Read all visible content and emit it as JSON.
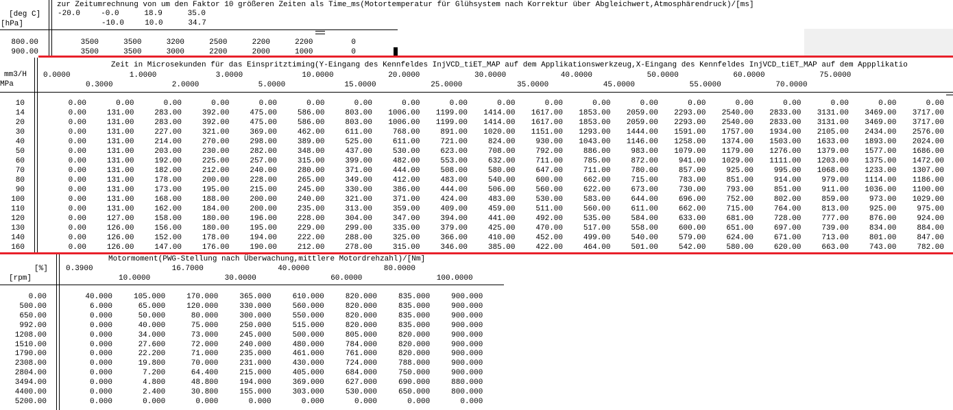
{
  "section1": {
    "title": "zur Zeitumrechnung von um den Faktor 10 größeren Zeiten als Time_ms(Motortemperatur für Glühsystem nach Korrektur über Abgleichwert,Atmosphärendruck)/[ms]",
    "x_unit": "[deg C]",
    "y_unit": "[hPa]",
    "x_row1": [
      "-20.0",
      "-0.0",
      "18.9",
      "35.0"
    ],
    "x_row2": [
      "-10.0",
      "10.0",
      "34.7"
    ],
    "rows": [
      {
        "label": "800.00",
        "values": [
          "3500",
          "3500",
          "3200",
          "2500",
          "2200",
          "2200",
          "0"
        ]
      },
      {
        "label": "900.00",
        "values": [
          "3500",
          "3500",
          "3000",
          "2200",
          "2000",
          "1000",
          "0"
        ]
      }
    ]
  },
  "section2": {
    "title": "Zeit in Microsekunden für das Einspritztiming(Y-Eingang des Kennfeldes InjVCD_tiET_MAP auf dem Applikationswerkzeug,X-Eingang des Kennfeldes InjVCD_tiET_MAP auf dem Appplikatio",
    "x_unit": "mm3/H",
    "y_unit": "MPa",
    "x_row1": [
      "0.0000",
      "1.0000",
      "3.0000",
      "10.0000",
      "20.0000",
      "30.0000",
      "40.0000",
      "50.0000",
      "60.0000",
      "75.0000"
    ],
    "x_row2": [
      "0.3000",
      "2.0000",
      "5.0000",
      "15.0000",
      "25.0000",
      "35.0000",
      "45.0000",
      "55.0000",
      "70.0000"
    ],
    "rows": [
      {
        "label": "10",
        "values": [
          "0.00",
          "0.00",
          "0.00",
          "0.00",
          "0.00",
          "0.00",
          "0.00",
          "0.00",
          "0.00",
          "0.00",
          "0.00",
          "0.00",
          "0.00",
          "0.00",
          "0.00",
          "0.00",
          "0.00",
          "0.00",
          "0.00"
        ]
      },
      {
        "label": "14",
        "values": [
          "0.00",
          "131.00",
          "283.00",
          "392.00",
          "475.00",
          "586.00",
          "803.00",
          "1006.00",
          "1199.00",
          "1414.00",
          "1617.00",
          "1853.00",
          "2059.00",
          "2293.00",
          "2540.00",
          "2833.00",
          "3131.00",
          "3469.00",
          "3717.00"
        ]
      },
      {
        "label": "20",
        "values": [
          "0.00",
          "131.00",
          "283.00",
          "392.00",
          "475.00",
          "586.00",
          "803.00",
          "1006.00",
          "1199.00",
          "1414.00",
          "1617.00",
          "1853.00",
          "2059.00",
          "2293.00",
          "2540.00",
          "2833.00",
          "3131.00",
          "3469.00",
          "3717.00"
        ]
      },
      {
        "label": "30",
        "values": [
          "0.00",
          "131.00",
          "227.00",
          "321.00",
          "369.00",
          "462.00",
          "611.00",
          "768.00",
          "891.00",
          "1020.00",
          "1151.00",
          "1293.00",
          "1444.00",
          "1591.00",
          "1757.00",
          "1934.00",
          "2105.00",
          "2434.00",
          "2576.00"
        ]
      },
      {
        "label": "40",
        "values": [
          "0.00",
          "131.00",
          "214.00",
          "270.00",
          "298.00",
          "389.00",
          "525.00",
          "611.00",
          "721.00",
          "824.00",
          "930.00",
          "1043.00",
          "1146.00",
          "1258.00",
          "1374.00",
          "1503.00",
          "1633.00",
          "1893.00",
          "2024.00"
        ]
      },
      {
        "label": "50",
        "values": [
          "0.00",
          "131.00",
          "203.00",
          "230.00",
          "282.00",
          "348.00",
          "437.00",
          "530.00",
          "623.00",
          "708.00",
          "792.00",
          "886.00",
          "983.00",
          "1079.00",
          "1179.00",
          "1276.00",
          "1379.00",
          "1577.00",
          "1686.00"
        ]
      },
      {
        "label": "60",
        "values": [
          "0.00",
          "131.00",
          "192.00",
          "225.00",
          "257.00",
          "315.00",
          "399.00",
          "482.00",
          "553.00",
          "632.00",
          "711.00",
          "785.00",
          "872.00",
          "941.00",
          "1029.00",
          "1111.00",
          "1203.00",
          "1375.00",
          "1472.00"
        ]
      },
      {
        "label": "70",
        "values": [
          "0.00",
          "131.00",
          "182.00",
          "212.00",
          "240.00",
          "280.00",
          "371.00",
          "444.00",
          "508.00",
          "580.00",
          "647.00",
          "711.00",
          "780.00",
          "857.00",
          "925.00",
          "995.00",
          "1068.00",
          "1233.00",
          "1307.00"
        ]
      },
      {
        "label": "80",
        "values": [
          "0.00",
          "131.00",
          "178.00",
          "200.00",
          "228.00",
          "265.00",
          "349.00",
          "412.00",
          "483.00",
          "540.00",
          "600.00",
          "662.00",
          "715.00",
          "783.00",
          "851.00",
          "914.00",
          "979.00",
          "1114.00",
          "1186.00"
        ]
      },
      {
        "label": "90",
        "values": [
          "0.00",
          "131.00",
          "173.00",
          "195.00",
          "215.00",
          "245.00",
          "330.00",
          "386.00",
          "444.00",
          "506.00",
          "560.00",
          "622.00",
          "673.00",
          "730.00",
          "793.00",
          "851.00",
          "911.00",
          "1036.00",
          "1100.00"
        ]
      },
      {
        "label": "100",
        "values": [
          "0.00",
          "131.00",
          "168.00",
          "188.00",
          "200.00",
          "240.00",
          "321.00",
          "371.00",
          "424.00",
          "483.00",
          "530.00",
          "583.00",
          "644.00",
          "696.00",
          "752.00",
          "802.00",
          "859.00",
          "973.00",
          "1029.00"
        ]
      },
      {
        "label": "110",
        "values": [
          "0.00",
          "131.00",
          "162.00",
          "184.00",
          "200.00",
          "235.00",
          "313.00",
          "359.00",
          "409.00",
          "459.00",
          "511.00",
          "560.00",
          "611.00",
          "662.00",
          "715.00",
          "764.00",
          "813.00",
          "925.00",
          "975.00"
        ]
      },
      {
        "label": "120",
        "values": [
          "0.00",
          "127.00",
          "158.00",
          "180.00",
          "196.00",
          "228.00",
          "304.00",
          "347.00",
          "394.00",
          "441.00",
          "492.00",
          "535.00",
          "584.00",
          "633.00",
          "681.00",
          "728.00",
          "777.00",
          "876.00",
          "924.00"
        ]
      },
      {
        "label": "130",
        "values": [
          "0.00",
          "126.00",
          "156.00",
          "180.00",
          "195.00",
          "229.00",
          "299.00",
          "335.00",
          "379.00",
          "425.00",
          "470.00",
          "517.00",
          "558.00",
          "600.00",
          "651.00",
          "697.00",
          "739.00",
          "834.00",
          "884.00"
        ]
      },
      {
        "label": "140",
        "values": [
          "0.00",
          "126.00",
          "152.00",
          "178.00",
          "194.00",
          "222.00",
          "288.00",
          "325.00",
          "366.00",
          "410.00",
          "452.00",
          "499.00",
          "540.00",
          "579.00",
          "624.00",
          "671.00",
          "713.00",
          "801.00",
          "847.00"
        ]
      },
      {
        "label": "160",
        "values": [
          "0.00",
          "126.00",
          "147.00",
          "176.00",
          "190.00",
          "212.00",
          "278.00",
          "315.00",
          "346.00",
          "385.00",
          "422.00",
          "464.00",
          "501.00",
          "542.00",
          "580.00",
          "620.00",
          "663.00",
          "743.00",
          "782.00"
        ]
      }
    ]
  },
  "section3": {
    "title": "Motormoment(PWG-Stellung nach Überwachung,mittlere Motordrehzahl)/[Nm]",
    "x_unit": "[%]",
    "y_unit": "[rpm]",
    "x_row1": [
      "0.3900",
      "16.7000",
      "40.0000",
      "80.0000"
    ],
    "x_row2": [
      "10.0000",
      "30.0000",
      "60.0000",
      "100.0000"
    ],
    "rows": [
      {
        "label": "0.00",
        "values": [
          "40.000",
          "105.000",
          "170.000",
          "365.000",
          "610.000",
          "820.000",
          "835.000",
          "900.000"
        ]
      },
      {
        "label": "500.00",
        "values": [
          "6.000",
          "65.000",
          "120.000",
          "330.000",
          "560.000",
          "820.000",
          "835.000",
          "900.000"
        ]
      },
      {
        "label": "650.00",
        "values": [
          "0.000",
          "50.000",
          "80.000",
          "300.000",
          "550.000",
          "820.000",
          "835.000",
          "900.000"
        ]
      },
      {
        "label": "992.00",
        "values": [
          "0.000",
          "40.000",
          "75.000",
          "250.000",
          "515.000",
          "820.000",
          "835.000",
          "900.000"
        ]
      },
      {
        "label": "1208.00",
        "values": [
          "0.000",
          "34.000",
          "73.000",
          "245.000",
          "500.000",
          "805.000",
          "820.000",
          "900.000"
        ]
      },
      {
        "label": "1510.00",
        "values": [
          "0.000",
          "27.600",
          "72.000",
          "240.000",
          "480.000",
          "784.000",
          "820.000",
          "900.000"
        ]
      },
      {
        "label": "1790.00",
        "values": [
          "0.000",
          "22.200",
          "71.000",
          "235.000",
          "461.000",
          "761.000",
          "820.000",
          "900.000"
        ]
      },
      {
        "label": "2308.00",
        "values": [
          "0.000",
          "19.800",
          "70.000",
          "231.000",
          "430.000",
          "724.000",
          "788.000",
          "900.000"
        ]
      },
      {
        "label": "2804.00",
        "values": [
          "0.000",
          "7.200",
          "64.400",
          "215.000",
          "405.000",
          "684.000",
          "750.000",
          "900.000"
        ]
      },
      {
        "label": "3494.00",
        "values": [
          "0.000",
          "4.800",
          "48.800",
          "194.000",
          "369.000",
          "627.000",
          "690.000",
          "880.000"
        ]
      },
      {
        "label": "4400.00",
        "values": [
          "0.000",
          "2.400",
          "30.800",
          "155.000",
          "303.000",
          "530.000",
          "650.000",
          "800.000"
        ]
      },
      {
        "label": "5200.00",
        "values": [
          "0.000",
          "0.000",
          "0.000",
          "0.000",
          "0.000",
          "0.000",
          "0.000",
          "0.000"
        ]
      }
    ]
  },
  "colors": {
    "separator": "#e8202a",
    "panel": "#f0f0f0"
  }
}
